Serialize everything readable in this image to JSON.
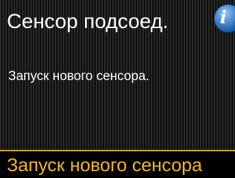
{
  "screen": {
    "title": "Сенсор подсоед.",
    "message": "Запуск нового сенсора.",
    "info_icon": "info-icon",
    "action_label": "Запуск нового сенсора"
  },
  "colors": {
    "background": "#1f1f1f",
    "text": "#ffffff",
    "action_text": "#f6b80f",
    "action_border": "#e8a90f",
    "info_button": "#1a5ba8"
  }
}
